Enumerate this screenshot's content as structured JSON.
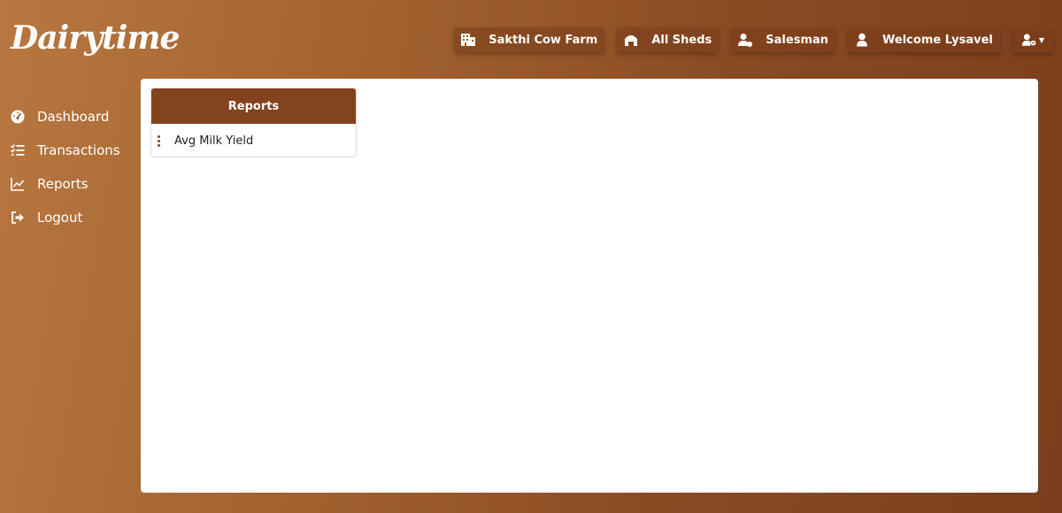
{
  "app": {
    "logo": "Dairytime"
  },
  "topbar": {
    "farm": "Sakthi Cow Farm",
    "sheds": "All Sheds",
    "role": "Salesman",
    "welcome": "Welcome Lysavel",
    "icons": [
      "building-icon",
      "shed-icon",
      "user-tag-icon",
      "user-icon",
      "user-gear-icon"
    ]
  },
  "sidebar": {
    "items": [
      {
        "label": "Dashboard",
        "icon": "gauge-icon"
      },
      {
        "label": "Transactions",
        "icon": "list-check-icon"
      },
      {
        "label": "Reports",
        "icon": "chart-line-icon"
      },
      {
        "label": "Logout",
        "icon": "logout-icon"
      }
    ]
  },
  "reports_card": {
    "title": "Reports",
    "items": [
      {
        "label": "Avg Milk Yield"
      }
    ]
  },
  "colors": {
    "accent": "#84431f",
    "panel": "#ffffff"
  }
}
